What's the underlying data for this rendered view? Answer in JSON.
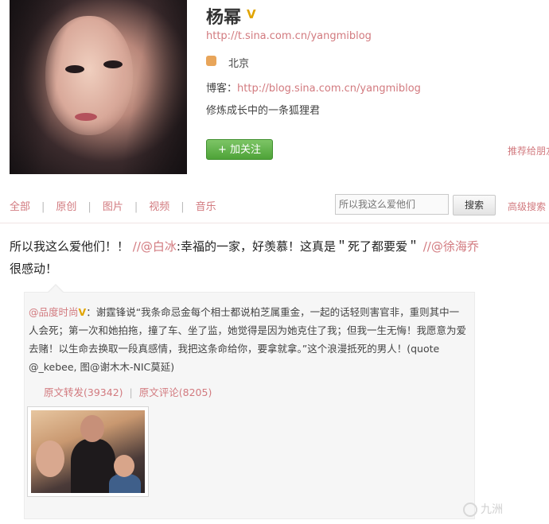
{
  "profile": {
    "name": "杨幂",
    "verified_badge": "V",
    "url": "http://t.sina.com.cn/yangmiblog",
    "location_icon": "user-location-icon",
    "location": "北京",
    "blog_label": "博客：",
    "blog_url": "http://blog.sina.com.cn/yangmiblog",
    "bio": "修炼成长中的一条狐狸君",
    "follow_button": "+ 加关注",
    "recommend_link": "推荐给朋友"
  },
  "tabs": [
    "全部",
    "原创",
    "图片",
    "视频",
    "音乐"
  ],
  "search": {
    "placeholder": "所以我这么爱他们",
    "button": "搜索",
    "advanced": "高级搜索"
  },
  "post": {
    "text_start": "所以我这么爱他们！！ ",
    "mention1": "//@白冰",
    "text_mid": ":幸福的一家，好羡慕！这真是＂死了都要爱＂ ",
    "mention2": "//@徐海乔",
    "text_end": "很感动！"
  },
  "repost": {
    "author": "@品度时尚",
    "badge": "V",
    "text": "：谢霆锋说“我条命忌金每个相士都说柏芝属重金，一起的话轻则害官非，重则其中一人会死；第一次和她拍拖，撞了车、坐了监，她觉得是因为她克住了我；但我一生无悔！我愿意为爱去赌！以生命去换取一段真感情，我把这条命给你，要拿就拿。”这个浪漫抵死的男人！(quote @_kebee, 图@谢木木-NIC莫延)",
    "forward_label": "原文转发(39342)",
    "comment_label": "原文评论(8205)"
  },
  "watermark": "九洲"
}
